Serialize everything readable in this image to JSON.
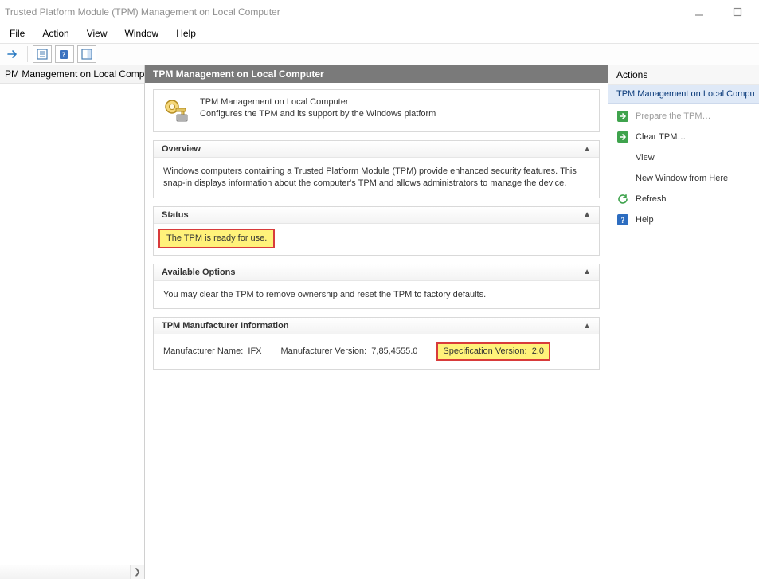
{
  "window": {
    "title": "Trusted Platform Module (TPM) Management on Local Computer"
  },
  "menu": {
    "file": "File",
    "action": "Action",
    "view": "View",
    "window": "Window",
    "help": "Help"
  },
  "tree": {
    "root": "PM Management on Local Comp"
  },
  "header": {
    "title": "TPM Management on Local Computer"
  },
  "intro": {
    "title": "TPM Management on Local Computer",
    "desc": "Configures the TPM and its support by the Windows platform"
  },
  "overview": {
    "title": "Overview",
    "body": "Windows computers containing a Trusted Platform Module (TPM) provide enhanced security features. This snap-in displays information about the computer's TPM and allows administrators to manage the device."
  },
  "status": {
    "title": "Status",
    "message": "The TPM is ready for use."
  },
  "options": {
    "title": "Available Options",
    "body": "You may clear the TPM to remove ownership and reset the TPM to factory defaults."
  },
  "mfr": {
    "title": "TPM Manufacturer Information",
    "name_label": "Manufacturer Name:",
    "name_value": "IFX",
    "version_label": "Manufacturer Version:",
    "version_value": "7,85,4555.0",
    "spec_label": "Specification Version:",
    "spec_value": "2.0"
  },
  "actions": {
    "pane_title": "Actions",
    "sub_title": "TPM Management on Local Compu",
    "items": {
      "prepare": "Prepare the TPM…",
      "clear": "Clear TPM…",
      "view": "View",
      "new_window": "New Window from Here",
      "refresh": "Refresh",
      "help": "Help"
    }
  }
}
